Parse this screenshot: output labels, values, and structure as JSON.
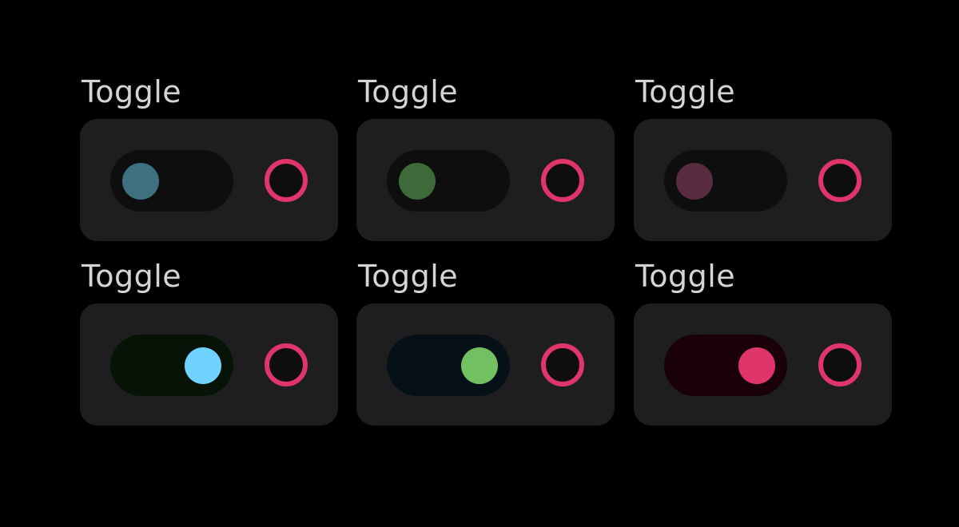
{
  "toggles": [
    {
      "label": "Toggle",
      "checked": false,
      "track_color": "#0e0e0e",
      "knob_color": "#3e7080",
      "ring_color": "#e0356a"
    },
    {
      "label": "Toggle",
      "checked": false,
      "track_color": "#0e0e0e",
      "knob_color": "#3e6a3a",
      "ring_color": "#e0356a"
    },
    {
      "label": "Toggle",
      "checked": false,
      "track_color": "#0e0e0e",
      "knob_color": "#5a2c42",
      "ring_color": "#e0356a"
    },
    {
      "label": "Toggle",
      "checked": true,
      "track_color": "#061306",
      "knob_color": "#6fd2ff",
      "ring_color": "#e0356a"
    },
    {
      "label": "Toggle",
      "checked": true,
      "track_color": "#051017",
      "knob_color": "#72c062",
      "ring_color": "#e0356a"
    },
    {
      "label": "Toggle",
      "checked": true,
      "track_color": "#19000a",
      "knob_color": "#e0356a",
      "ring_color": "#e0356a"
    }
  ]
}
